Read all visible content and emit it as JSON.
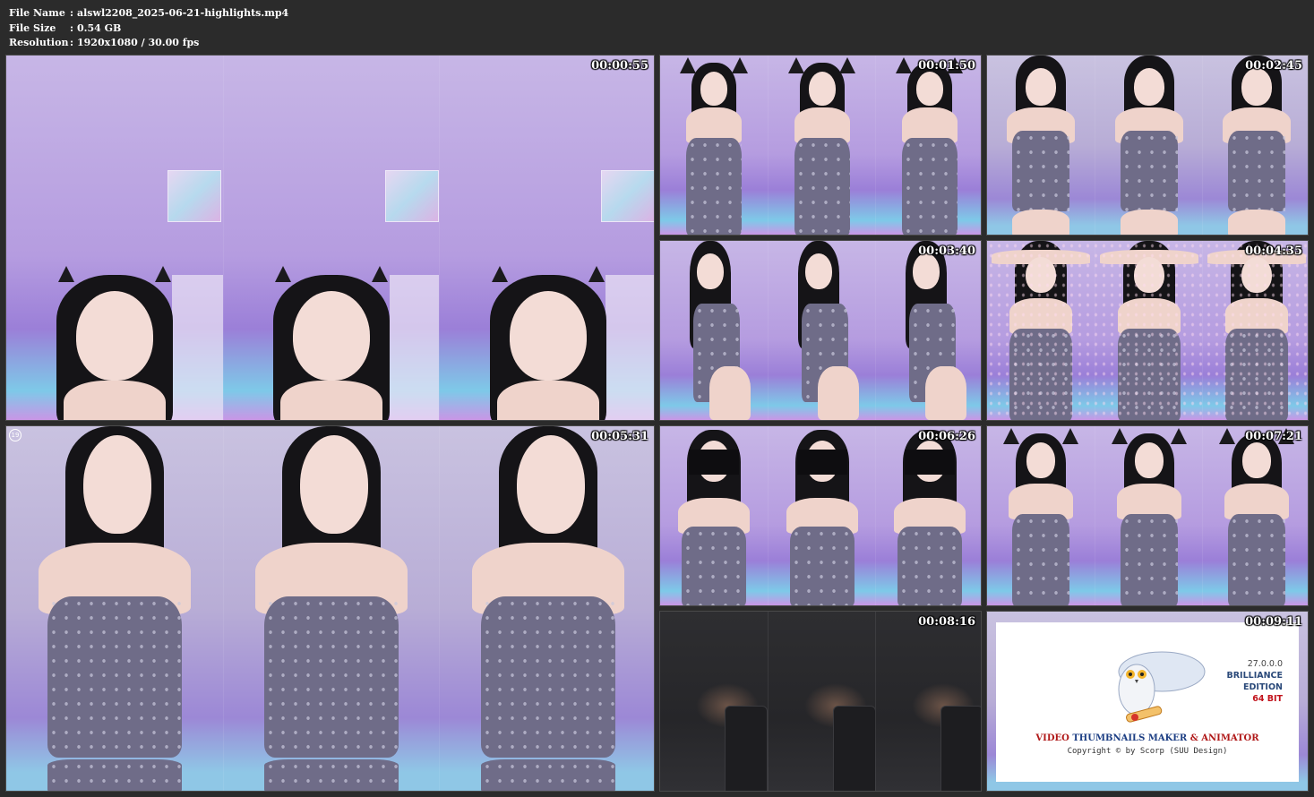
{
  "file_info": {
    "file_name_label": "File Name",
    "file_name": "alswl2208_2025-06-21-highlights.mp4",
    "file_size_label": "File Size",
    "file_size": "0.54 GB",
    "resolution_label": "Resolution",
    "resolution": "1920x1080 / 30.00 fps",
    "separator": ":"
  },
  "thumbnails": [
    {
      "timestamp": "00:00:55",
      "scene": "close-up with cat-ear headband"
    },
    {
      "timestamp": "00:01:50",
      "scene": "cat-ear headband, arms crossed"
    },
    {
      "timestamp": "00:02:45",
      "scene": "eyes closed, camisole"
    },
    {
      "timestamp": "00:03:40",
      "scene": "side pose"
    },
    {
      "timestamp": "00:04:35",
      "scene": "sparkle effect"
    },
    {
      "timestamp": "00:05:31",
      "scene": "close-up, hand on chest",
      "badge": "19"
    },
    {
      "timestamp": "00:06:26",
      "scene": "lace blindfold"
    },
    {
      "timestamp": "00:07:21",
      "scene": "cat-ear headband, standing"
    },
    {
      "timestamp": "00:08:16",
      "scene": "empty dark room with chair"
    },
    {
      "timestamp": "00:09:11",
      "scene": "watermark card"
    }
  ],
  "watermark": {
    "version": "27.0.0.0",
    "edition_line1": "BRILLIANCE",
    "edition_line2": "EDITION",
    "bitness": "64 BIT",
    "product_part1": "VIDEO",
    "product_part2": "THUMBNAILS MAKER",
    "product_part3": "& ANIMATOR",
    "copyright": "Copyright © by Scorp (SUU Design)"
  }
}
